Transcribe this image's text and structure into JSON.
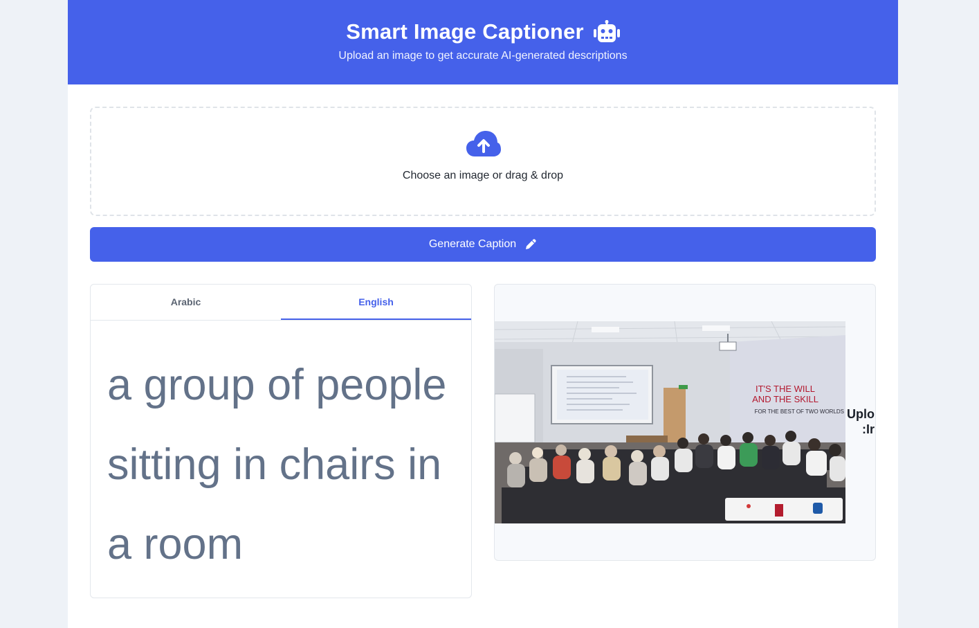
{
  "header": {
    "title": "Smart Image Captioner",
    "title_icon": "robot-icon",
    "subtitle": "Upload an image to get accurate AI-generated descriptions"
  },
  "upload": {
    "icon": "cloud-upload-icon",
    "prompt": "Choose an image or drag & drop"
  },
  "generate_button": {
    "label": "Generate Caption",
    "icon": "pencil-icon"
  },
  "tabs": [
    {
      "label": "Arabic",
      "active": false
    },
    {
      "label": "English",
      "active": true
    }
  ],
  "caption": {
    "text": "a group of people sitting in chairs in a room"
  },
  "preview": {
    "alt_line1": "Uplo",
    "alt_line2": ":Ir",
    "wall_text_1": "IT'S THE WILL",
    "wall_text_2": "AND THE SKILL",
    "wall_text_3": "FOR THE BEST OF TWO WORLDS"
  },
  "colors": {
    "primary": "#4561ea",
    "page_bg": "#eef2f7",
    "caption_text": "#637289"
  }
}
